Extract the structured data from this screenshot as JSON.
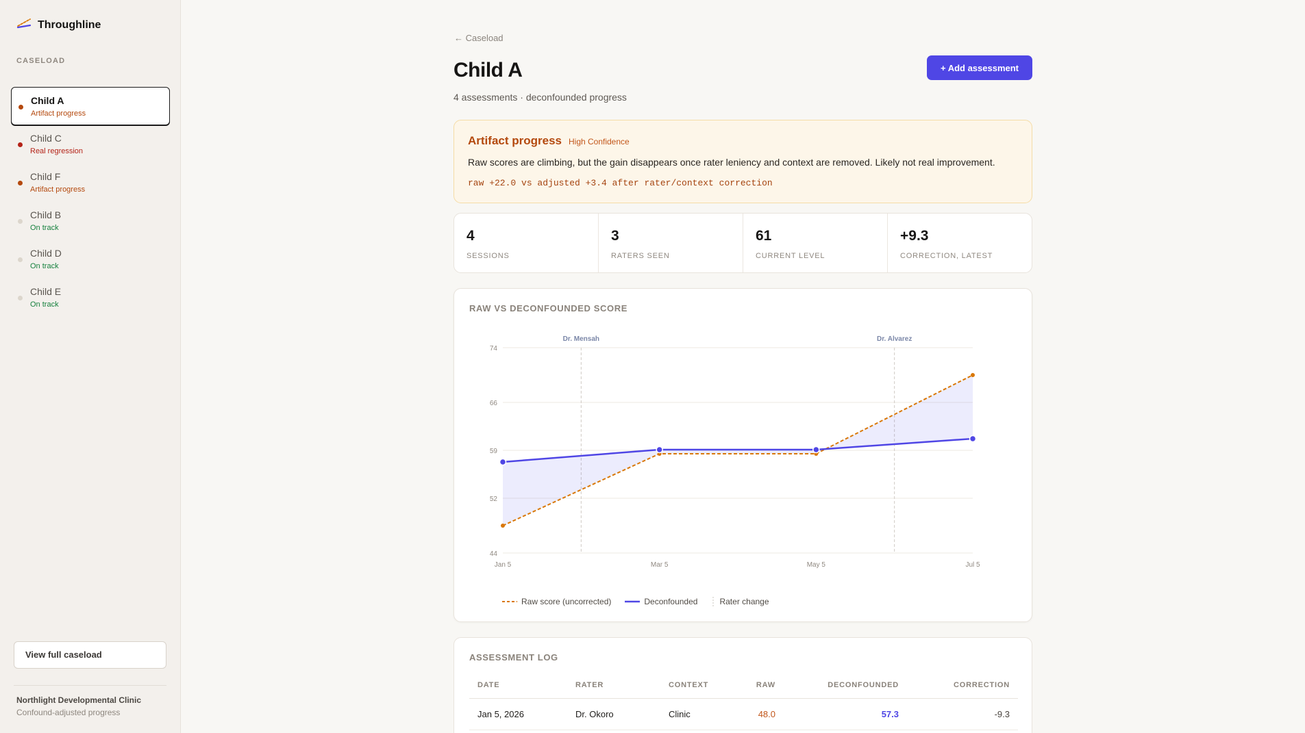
{
  "app": {
    "name": "Throughline"
  },
  "sidebar": {
    "section_label": "CASELOAD",
    "clients": [
      {
        "name": "Child A",
        "status": "Artifact progress",
        "status_color": "#b4490e",
        "dot_color": "#b4490e",
        "active": true
      },
      {
        "name": "Child C",
        "status": "Real regression",
        "status_color": "#b42318",
        "dot_color": "#b42318"
      },
      {
        "name": "Child F",
        "status": "Artifact progress",
        "status_color": "#b4490e",
        "dot_color": "#b4490e"
      },
      {
        "name": "Child B",
        "status": "On track",
        "status_color": "#15803d",
        "dot_color": "#dcd6cc"
      },
      {
        "name": "Child D",
        "status": "On track",
        "status_color": "#15803d",
        "dot_color": "#dcd6cc"
      },
      {
        "name": "Child E",
        "status": "On track",
        "status_color": "#15803d",
        "dot_color": "#dcd6cc"
      }
    ],
    "view_full_label": "View full caseload",
    "clinic_name": "Northlight Developmental Clinic",
    "clinic_sub": "Confound-adjusted progress"
  },
  "main": {
    "back_label": "← Caseload",
    "title": "Child A",
    "subtitle": "4 assessments · deconfounded progress",
    "add_button_label": "+ Add assessment",
    "alert": {
      "title": "Artifact progress",
      "confidence": "High Confidence",
      "body": "Raw scores are climbing, but the gain disappears once rater leniency and context are removed. Likely not real improvement.",
      "code": "raw +22.0 vs adjusted +3.4 after rater/context correction"
    },
    "stats": [
      {
        "value": "4",
        "label": "SESSIONS"
      },
      {
        "value": "3",
        "label": "RATERS SEEN"
      },
      {
        "value": "61",
        "label": "CURRENT LEVEL"
      },
      {
        "value": "+9.3",
        "label": "CORRECTION, LATEST"
      }
    ],
    "chart_title": "RAW VS DECONFOUNDED SCORE",
    "legend": {
      "raw": "Raw score (uncorrected)",
      "deconfounded": "Deconfounded",
      "rater_change": "Rater change"
    },
    "log": {
      "title": "ASSESSMENT LOG",
      "columns": [
        "DATE",
        "RATER",
        "CONTEXT",
        "RAW",
        "DECONFOUNDED",
        "CORRECTION"
      ],
      "rows": [
        {
          "date": "Jan 5, 2026",
          "rater": "Dr. Okoro",
          "context": "Clinic",
          "raw": "48.0",
          "deconfounded": "57.3",
          "correction": "-9.3"
        }
      ]
    }
  },
  "colors": {
    "accent": "#4f46e5",
    "raw": "#d97706",
    "warning_text": "#b4490e"
  },
  "chart_data": {
    "type": "line",
    "title": "RAW VS DECONFOUNDED SCORE",
    "categories": [
      "Jan 5",
      "Mar 5",
      "May 5",
      "Jul 5"
    ],
    "y_ticks": [
      44,
      52,
      59,
      66,
      74
    ],
    "ylim": [
      44,
      74
    ],
    "series": [
      {
        "name": "Raw score (uncorrected)",
        "values": [
          48.0,
          58.5,
          58.5,
          70.0
        ],
        "color": "#d97706",
        "style": "dashed"
      },
      {
        "name": "Deconfounded",
        "values": [
          57.3,
          59.1,
          59.1,
          60.7
        ],
        "color": "#4f46e5",
        "style": "solid"
      }
    ],
    "rater_changes": [
      {
        "label": "Dr. Mensah",
        "at": "Feb 5"
      },
      {
        "label": "Dr. Alvarez",
        "at": "Jun 5"
      }
    ],
    "grid": true
  }
}
